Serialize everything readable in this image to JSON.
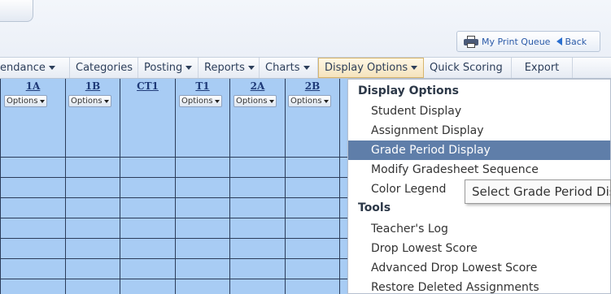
{
  "toolbar": {
    "print_queue_label": "My Print Queue",
    "back_label": "Back"
  },
  "nav": {
    "items": [
      {
        "label": "endance",
        "dropdown": true
      },
      {
        "label": "Categories",
        "dropdown": false
      },
      {
        "label": "Posting",
        "dropdown": true
      },
      {
        "label": "Reports",
        "dropdown": true
      },
      {
        "label": "Charts",
        "dropdown": true
      },
      {
        "label": "Display Options",
        "dropdown": true,
        "active": true
      },
      {
        "label": "Quick Scoring",
        "dropdown": false
      },
      {
        "label": "Export",
        "dropdown": false
      }
    ]
  },
  "grid": {
    "columns": [
      {
        "header": "1A",
        "options": "Options"
      },
      {
        "header": "1B",
        "options": "Options"
      },
      {
        "header": "CT1",
        "options": ""
      },
      {
        "header": "T1",
        "options": "Options"
      },
      {
        "header": "2A",
        "options": "Options"
      },
      {
        "header": "2B",
        "options": "Options"
      }
    ]
  },
  "menu": {
    "section1_title": "Display Options",
    "section1_items": [
      "Student Display",
      "Assignment Display",
      "Grade Period Display",
      "Modify Gradesheet Sequence",
      "Color Legend"
    ],
    "highlighted": "Grade Period Display",
    "section2_title": "Tools",
    "section2_items": [
      "Teacher's Log",
      "Drop Lowest Score",
      "Advanced Drop Lowest Score",
      "Restore Deleted Assignments"
    ]
  },
  "tooltip": {
    "text": "Select Grade Period Display"
  },
  "colors": {
    "grid_bg": "#a8ccf4",
    "menu_highlight": "#5f7ea9",
    "active_tab": "#f5e3bd"
  }
}
